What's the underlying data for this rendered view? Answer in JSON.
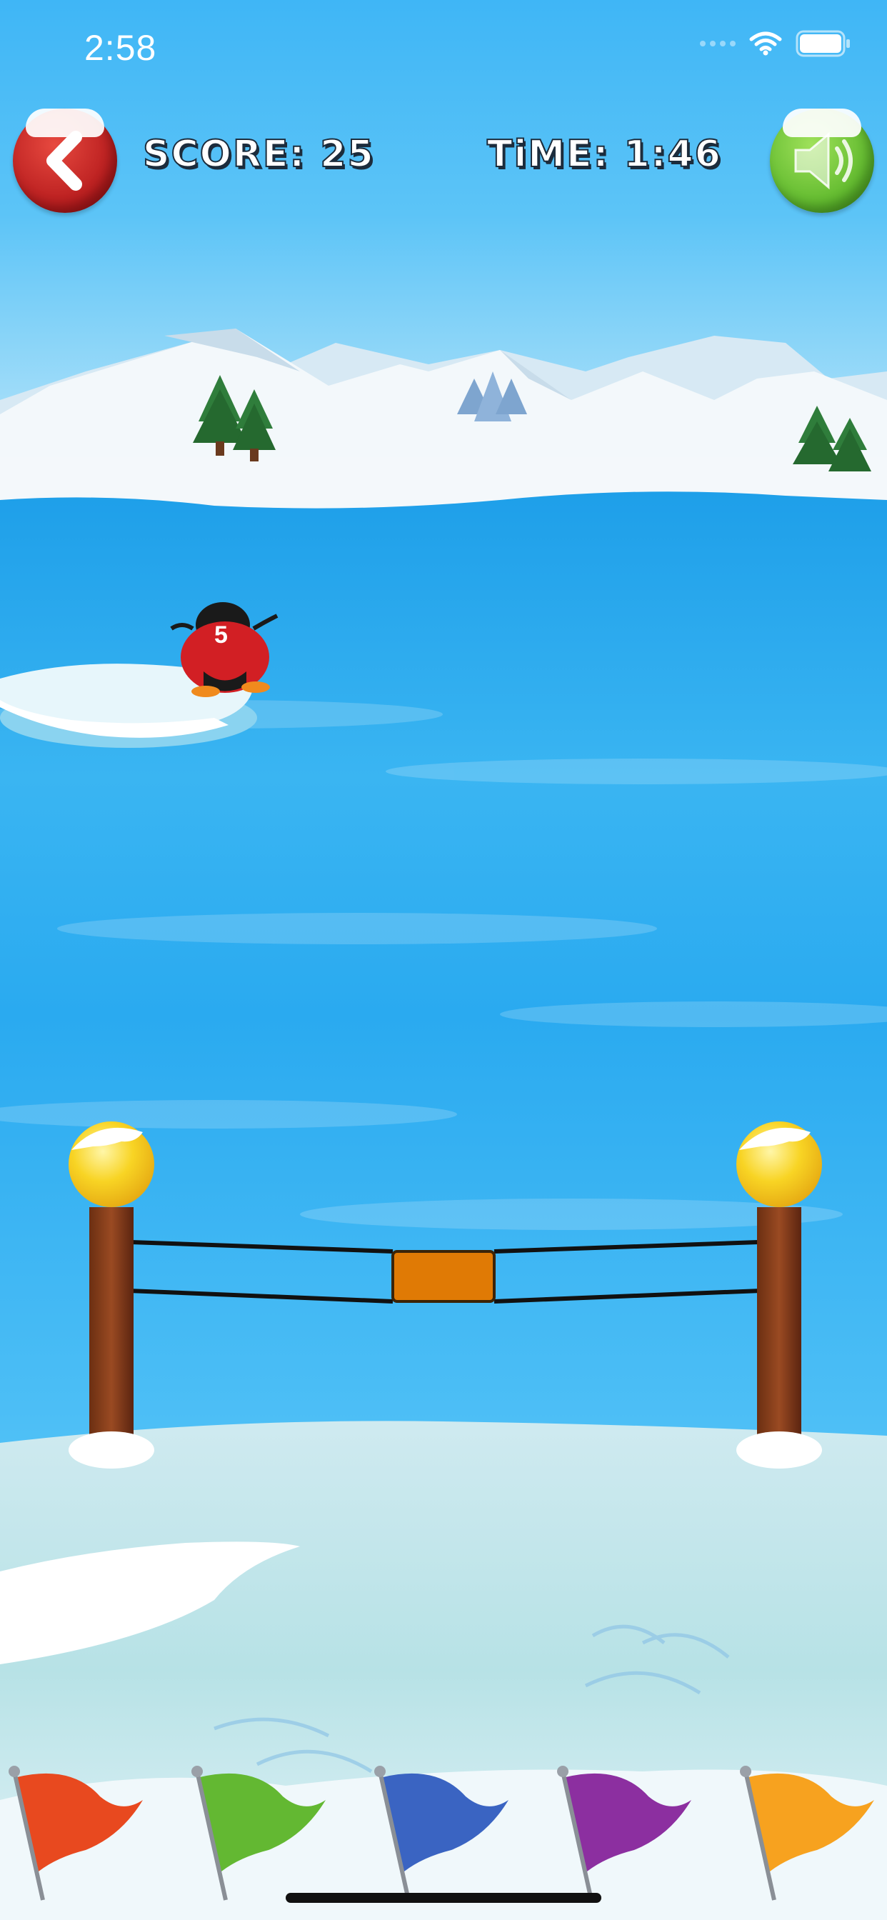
{
  "status_bar": {
    "time": "2:58"
  },
  "hud": {
    "score_text": "SCORE:  25",
    "time_text": "TiME:  1:46",
    "back_button": {
      "icon": "back-arrow-icon"
    },
    "sound_button": {
      "icon": "speaker-icon"
    }
  },
  "player": {
    "jersey_number": "5"
  },
  "colors": {
    "back_button": "#c62127",
    "sound_button": "#6cc33a",
    "water": "#36b2f2",
    "gate_handle": "#e07a05",
    "lamp": "#f7d022"
  },
  "flags": [
    {
      "color": "#e8491f"
    },
    {
      "color": "#63b832"
    },
    {
      "color": "#3a64c2"
    },
    {
      "color": "#8c2fa0"
    },
    {
      "color": "#f7a21f"
    }
  ]
}
